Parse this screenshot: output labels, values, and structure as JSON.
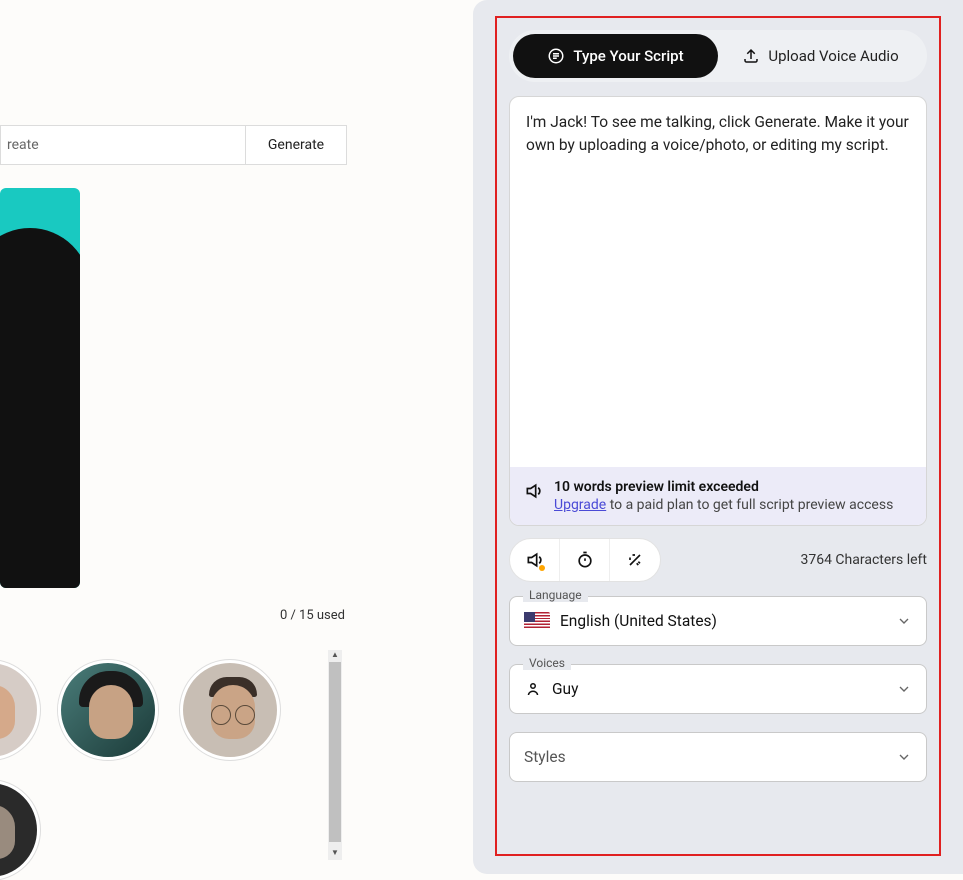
{
  "topbar": {
    "left_text": "reate",
    "generate_label": "Generate"
  },
  "usage": {
    "text": "0 / 15 used"
  },
  "tabs": {
    "type_script": "Type Your Script",
    "upload_audio": "Upload Voice Audio"
  },
  "script": {
    "text": "I'm Jack! To see me talking, click Generate. Make it your own by uploading a voice/photo, or editing my script."
  },
  "limit": {
    "title": "10 words preview limit exceeded",
    "upgrade_link": "Upgrade",
    "sub_text": " to a paid plan to get full script preview access"
  },
  "chars_left": "3764 Characters left",
  "language": {
    "label": "Language",
    "value": "English (United States)"
  },
  "voices": {
    "label": "Voices",
    "value": "Guy"
  },
  "styles": {
    "label": "Styles"
  }
}
